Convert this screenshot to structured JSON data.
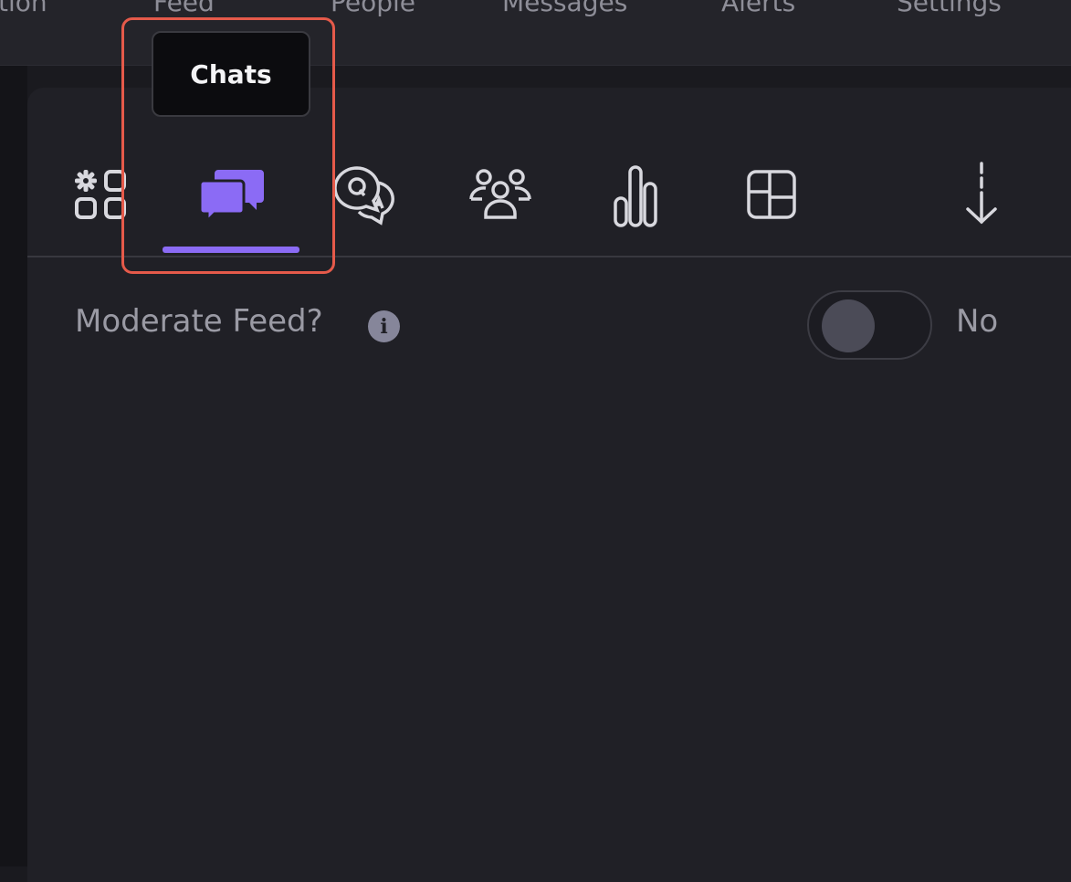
{
  "topnav": {
    "items": [
      "tion",
      "Feed",
      "People",
      "Messages",
      "Alerts",
      "Settings"
    ]
  },
  "tabs": [
    {
      "icon": "apps-settings-icon",
      "label": ""
    },
    {
      "icon": "chat-bubbles-icon",
      "label": "Chats",
      "active": true
    },
    {
      "icon": "qa-bubbles-icon",
      "label": ""
    },
    {
      "icon": "people-group-icon",
      "label": ""
    },
    {
      "icon": "bar-chart-icon",
      "label": ""
    },
    {
      "icon": "layout-grid-icon",
      "label": ""
    },
    {
      "icon": "download-arrow-icon",
      "label": ""
    }
  ],
  "tooltip": {
    "text": "Chats"
  },
  "setting": {
    "label": "Moderate Feed?",
    "info_glyph": "i",
    "toggle_value": "No",
    "enabled": false
  },
  "colors": {
    "accent": "#8b6bf5",
    "highlight": "#e55a4a",
    "background": "#202026",
    "icon": "#d8d8de"
  }
}
